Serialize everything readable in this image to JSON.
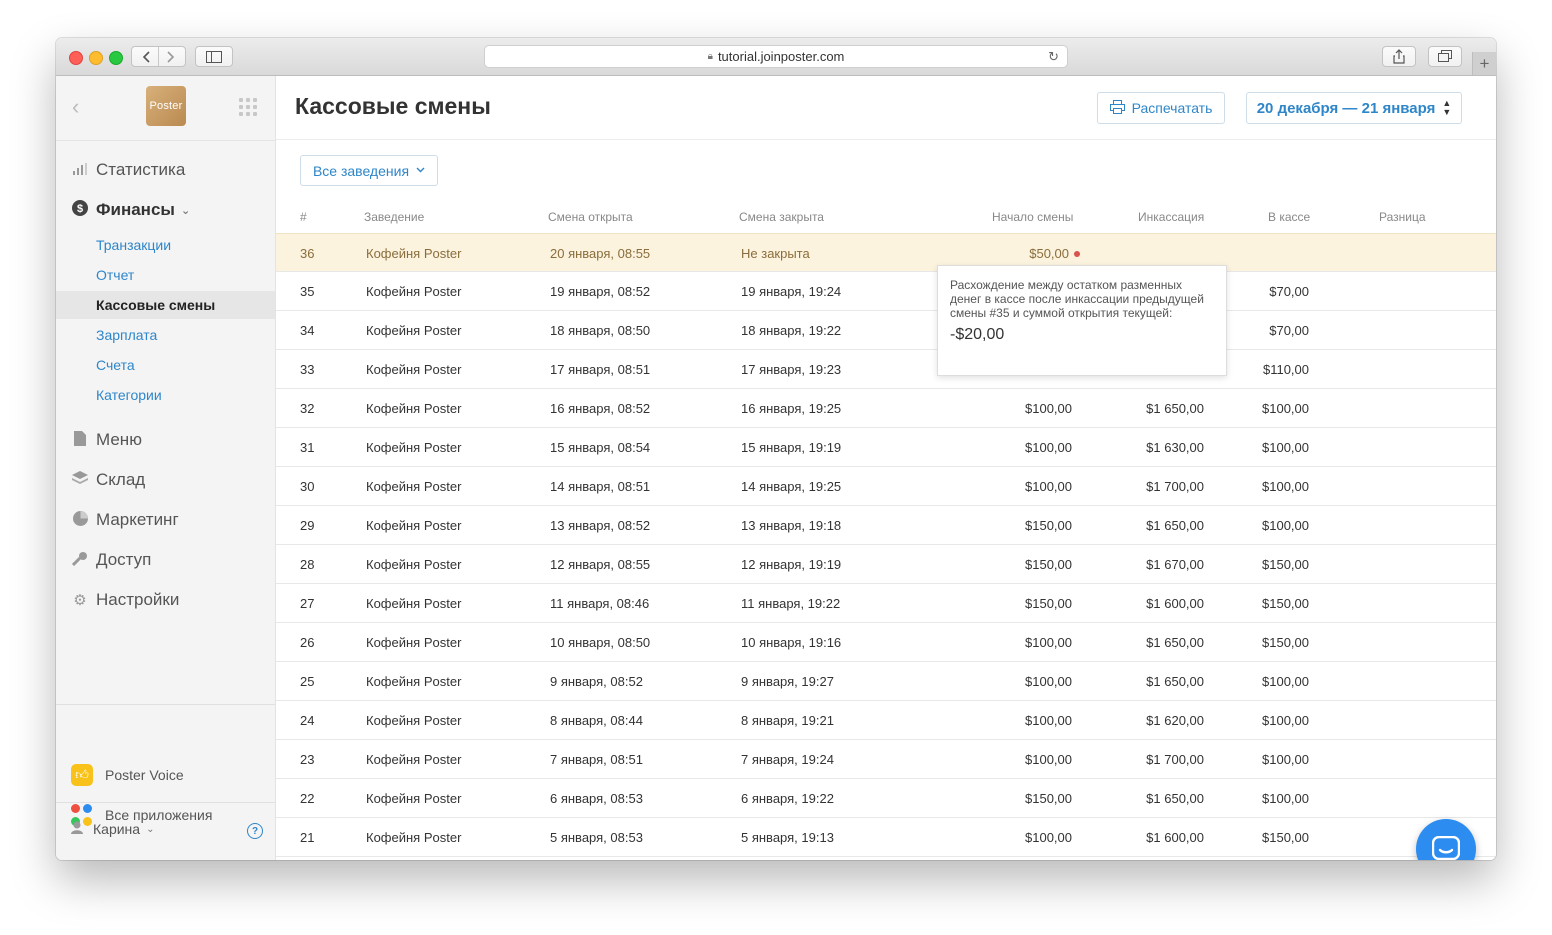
{
  "browser": {
    "url": "tutorial.joinposter.com"
  },
  "sidebar": {
    "logo_text": "Poster",
    "nav": [
      {
        "label": "Статистика",
        "icon": "bar-chart-icon"
      },
      {
        "label": "Финансы",
        "icon": "dollar-circle-icon"
      },
      {
        "label": "Меню",
        "icon": "document-icon"
      },
      {
        "label": "Склад",
        "icon": "layers-icon"
      },
      {
        "label": "Маркетинг",
        "icon": "pie-icon"
      },
      {
        "label": "Доступ",
        "icon": "key-icon"
      },
      {
        "label": "Настройки",
        "icon": "gear-icon"
      }
    ],
    "finance_sub": [
      {
        "label": "Транзакции"
      },
      {
        "label": "Отчет"
      },
      {
        "label": "Кассовые смены"
      },
      {
        "label": "Зарплата"
      },
      {
        "label": "Счета"
      },
      {
        "label": "Категории"
      }
    ],
    "apps": [
      {
        "label": "Poster Voice"
      },
      {
        "label": "Все приложения"
      }
    ],
    "user_name": "Карина",
    "help_glyph": "?"
  },
  "header": {
    "title": "Кассовые смены",
    "print_label": "Распечатать",
    "date_range": "20 декабря — 21 января"
  },
  "filter": {
    "label": "Все заведения"
  },
  "table": {
    "columns": [
      "#",
      "Заведение",
      "Смена открыта",
      "Смена закрыта",
      "Начало смены",
      "Инкассация",
      "В кассе",
      "Разница"
    ],
    "rows": [
      {
        "id": "36",
        "place": "Кофейня Poster",
        "opened": "20 января, 08:55",
        "closed": "Не закрыта",
        "start": "$50,00",
        "collection": "",
        "cash": "",
        "diff": ""
      },
      {
        "id": "35",
        "place": "Кофейня Poster",
        "opened": "19 января, 08:52",
        "closed": "19 января, 19:24",
        "start": "",
        "collection": "",
        "cash": "$70,00",
        "diff": ""
      },
      {
        "id": "34",
        "place": "Кофейня Poster",
        "opened": "18 января, 08:50",
        "closed": "18 января, 19:22",
        "start": "",
        "collection": "",
        "cash": "$70,00",
        "diff": ""
      },
      {
        "id": "33",
        "place": "Кофейня Poster",
        "opened": "17 января, 08:51",
        "closed": "17 января, 19:23",
        "start": "",
        "collection": "",
        "cash": "$110,00",
        "diff": ""
      },
      {
        "id": "32",
        "place": "Кофейня Poster",
        "opened": "16 января, 08:52",
        "closed": "16 января, 19:25",
        "start": "$100,00",
        "collection": "$1 650,00",
        "cash": "$100,00",
        "diff": ""
      },
      {
        "id": "31",
        "place": "Кофейня Poster",
        "opened": "15 января, 08:54",
        "closed": "15 января, 19:19",
        "start": "$100,00",
        "collection": "$1 630,00",
        "cash": "$100,00",
        "diff": ""
      },
      {
        "id": "30",
        "place": "Кофейня Poster",
        "opened": "14 января, 08:51",
        "closed": "14 января, 19:25",
        "start": "$100,00",
        "collection": "$1 700,00",
        "cash": "$100,00",
        "diff": ""
      },
      {
        "id": "29",
        "place": "Кофейня Poster",
        "opened": "13 января, 08:52",
        "closed": "13 января, 19:18",
        "start": "$150,00",
        "collection": "$1 650,00",
        "cash": "$100,00",
        "diff": ""
      },
      {
        "id": "28",
        "place": "Кофейня Poster",
        "opened": "12 января, 08:55",
        "closed": "12 января, 19:19",
        "start": "$150,00",
        "collection": "$1 670,00",
        "cash": "$150,00",
        "diff": ""
      },
      {
        "id": "27",
        "place": "Кофейня Poster",
        "opened": "11 января, 08:46",
        "closed": "11 января, 19:22",
        "start": "$150,00",
        "collection": "$1 600,00",
        "cash": "$150,00",
        "diff": ""
      },
      {
        "id": "26",
        "place": "Кофейня Poster",
        "opened": "10 января, 08:50",
        "closed": "10 января, 19:16",
        "start": "$100,00",
        "collection": "$1 650,00",
        "cash": "$150,00",
        "diff": ""
      },
      {
        "id": "25",
        "place": "Кофейня Poster",
        "opened": "9 января, 08:52",
        "closed": "9 января, 19:27",
        "start": "$100,00",
        "collection": "$1 650,00",
        "cash": "$100,00",
        "diff": ""
      },
      {
        "id": "24",
        "place": "Кофейня Poster",
        "opened": "8 января, 08:44",
        "closed": "8 января, 19:21",
        "start": "$100,00",
        "collection": "$1 620,00",
        "cash": "$100,00",
        "diff": ""
      },
      {
        "id": "23",
        "place": "Кофейня Poster",
        "opened": "7 января, 08:51",
        "closed": "7 января, 19:24",
        "start": "$100,00",
        "collection": "$1 700,00",
        "cash": "$100,00",
        "diff": ""
      },
      {
        "id": "22",
        "place": "Кофейня Poster",
        "opened": "6 января, 08:53",
        "closed": "6 января, 19:22",
        "start": "$150,00",
        "collection": "$1 650,00",
        "cash": "$100,00",
        "diff": ""
      },
      {
        "id": "21",
        "place": "Кофейня Poster",
        "opened": "5 января, 08:53",
        "closed": "5 января, 19:13",
        "start": "$100,00",
        "collection": "$1 600,00",
        "cash": "$150,00",
        "diff": ""
      }
    ]
  },
  "tooltip": {
    "text": "Расхождение между остатком разменных денег в кассе после инкассации предыдущей смены #35 и суммой открытия текущей:",
    "value": "-$20,00"
  },
  "colors": {
    "accent": "#2e86c9",
    "highlight_row": "#fbf3de",
    "alert_dot": "#d9534f",
    "chat_button": "#2d8cf0"
  }
}
